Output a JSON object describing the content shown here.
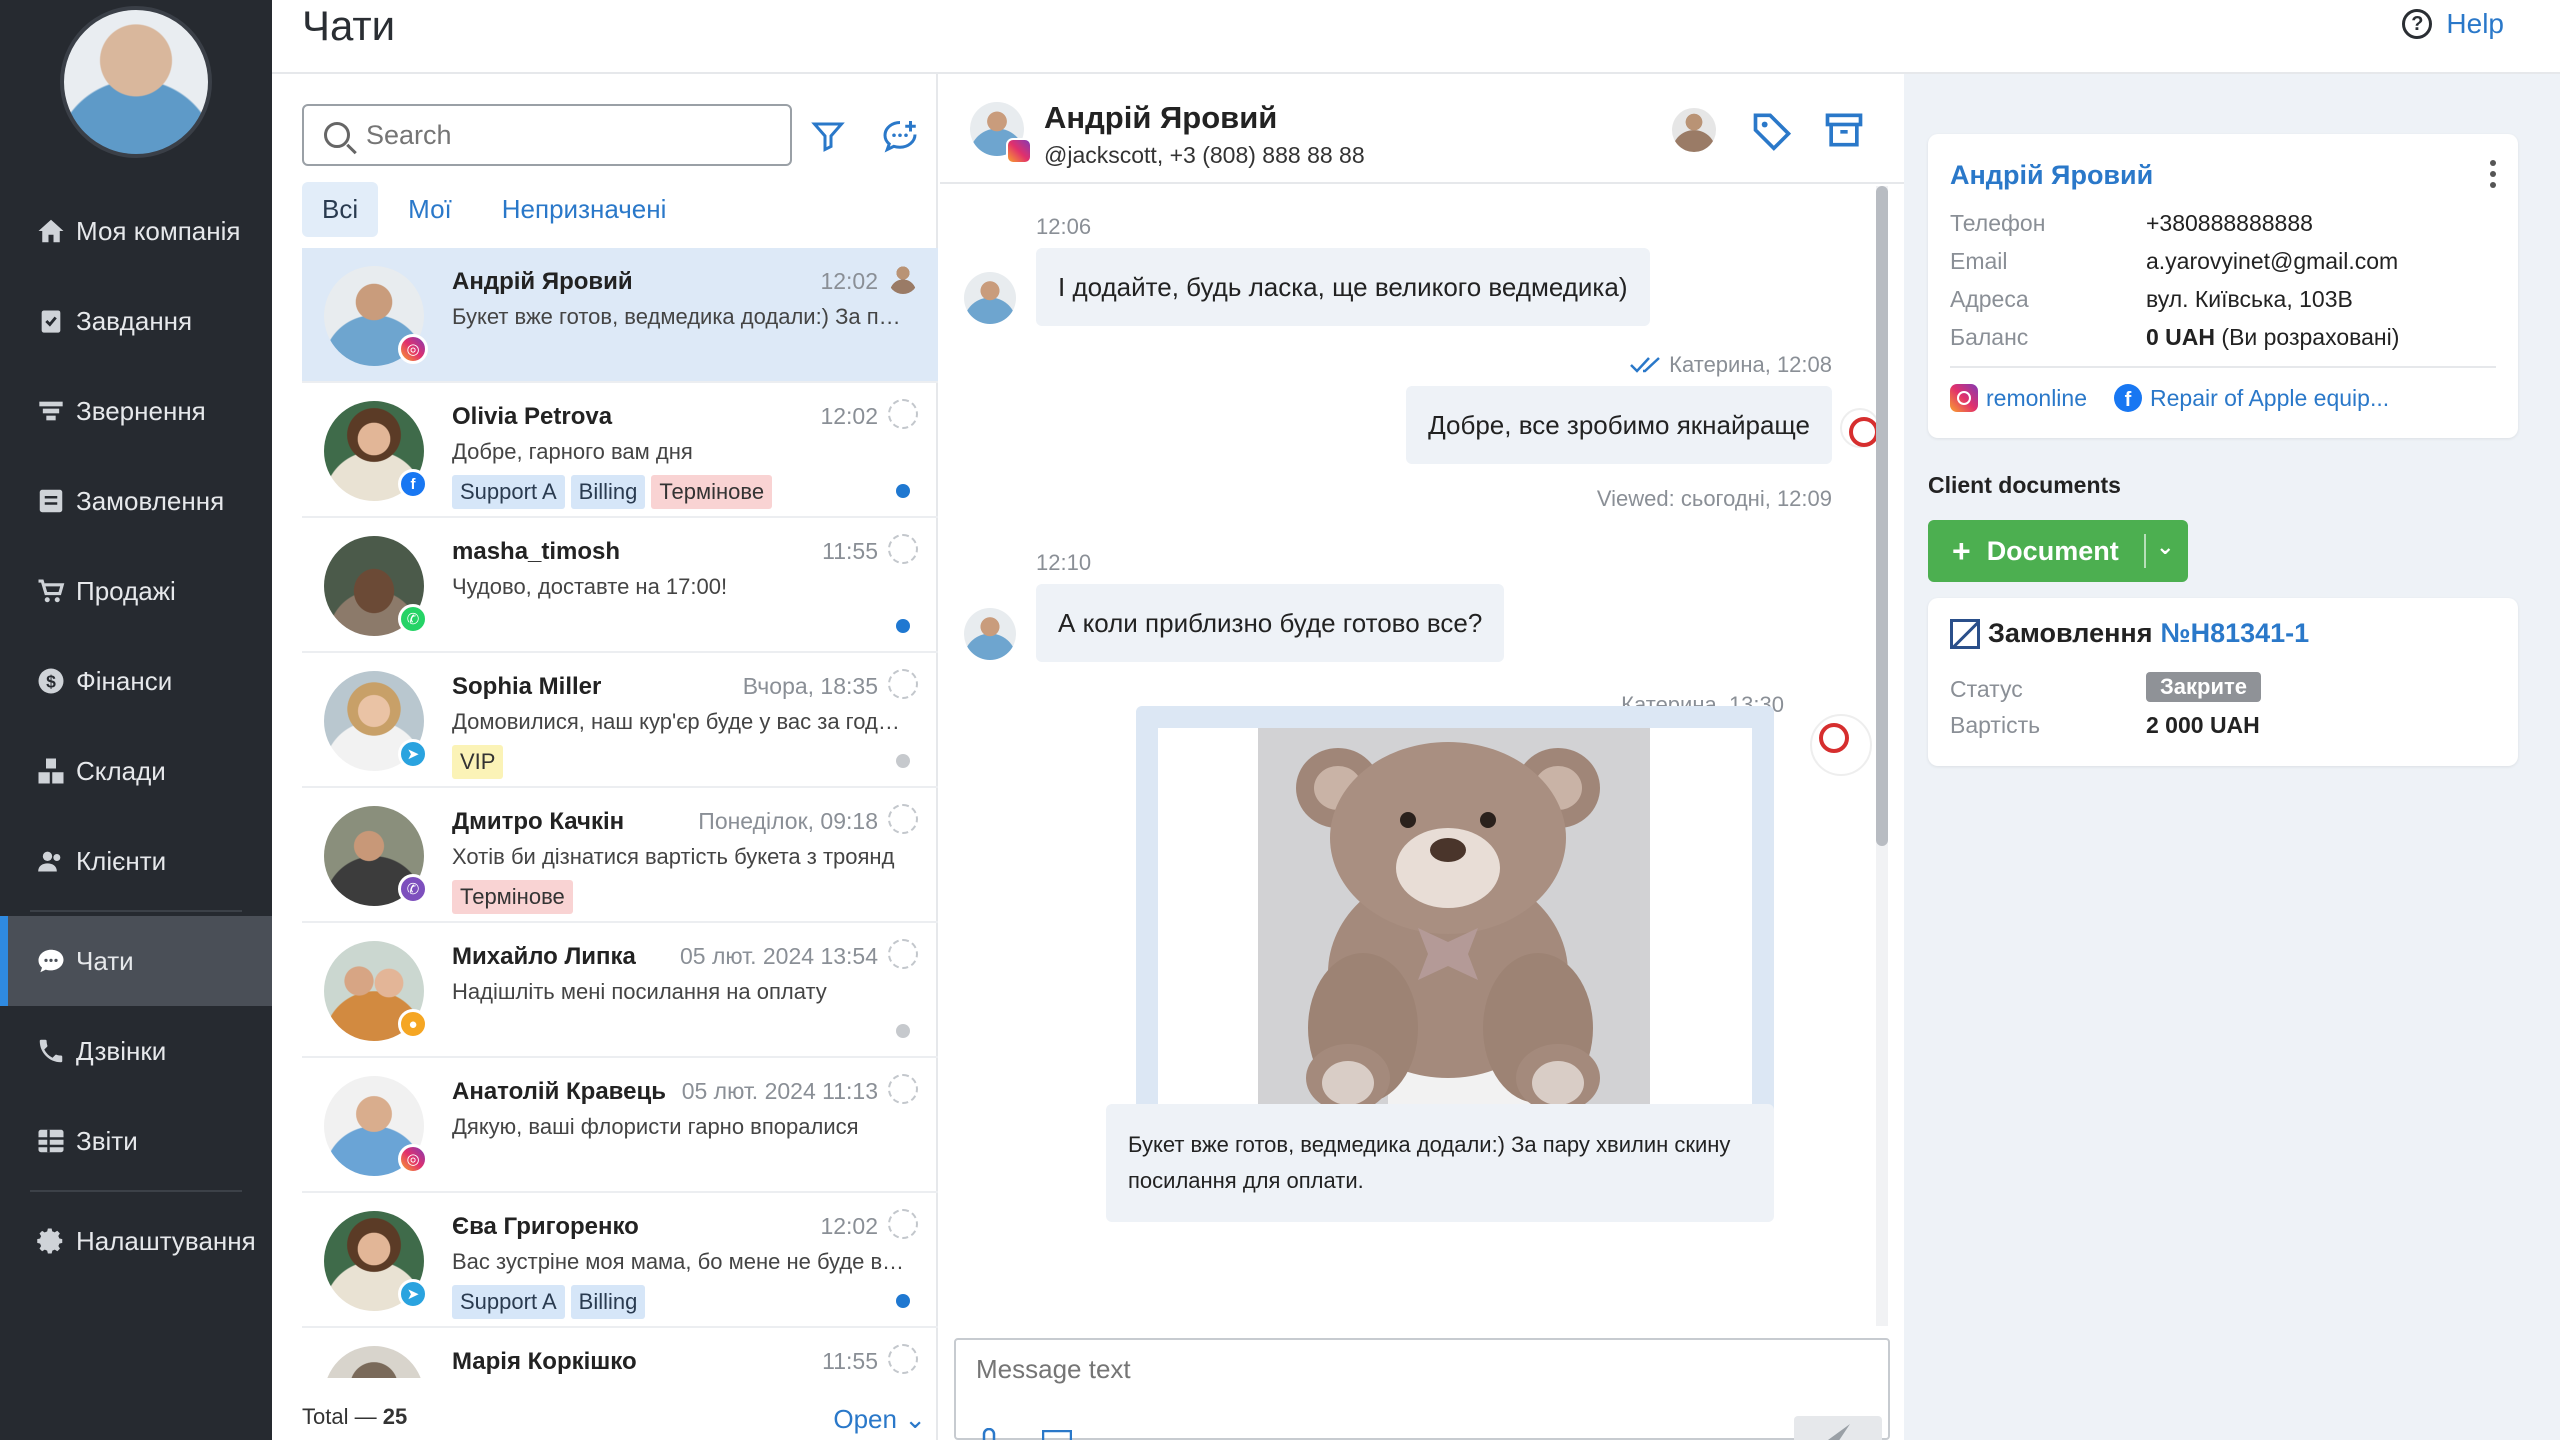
{
  "sidebar": {
    "items": [
      {
        "label": "Моя компанія",
        "icon": "home-icon"
      },
      {
        "label": "Завдання",
        "icon": "clipboard-icon"
      },
      {
        "label": "Звернення",
        "icon": "funnel-icon"
      },
      {
        "label": "Замовлення",
        "icon": "order-icon"
      },
      {
        "label": "Продажі",
        "icon": "cart-icon"
      },
      {
        "label": "Фінанси",
        "icon": "coin-icon"
      },
      {
        "label": "Склади",
        "icon": "boxes-icon"
      },
      {
        "label": "Клієнти",
        "icon": "users-icon"
      },
      {
        "label": "Чати",
        "icon": "chat-icon",
        "active": true
      },
      {
        "label": "Дзвінки",
        "icon": "phone-icon"
      },
      {
        "label": "Звіти",
        "icon": "reports-icon"
      },
      {
        "label": "Налаштування",
        "icon": "gear-icon"
      }
    ]
  },
  "header": {
    "title": "Чати",
    "help_label": "Help"
  },
  "chat_list": {
    "search_placeholder": "Search",
    "tabs": [
      "Всі",
      "Мої",
      "Непризначені"
    ],
    "rows": [
      {
        "name": "Андрій Яровий",
        "time": "12:02",
        "preview": "Букет вже готов, ведмедика додали:) За пару хвилин скину посилання для оплати.",
        "channel": "instagram",
        "tags": [],
        "dot": ""
      },
      {
        "name": "Olivia Petrova",
        "time": "12:02",
        "preview": "Добре, гарного вам дня",
        "channel": "facebook",
        "tags": [
          {
            "text": "Support A",
            "color": "blue"
          },
          {
            "text": "Billing",
            "color": "blue"
          },
          {
            "text": "Термінове",
            "color": "red"
          }
        ],
        "dot": "blue"
      },
      {
        "name": "masha_timosh",
        "time": "11:55",
        "preview": "Чудово, доставте на 17:00!",
        "channel": "whatsapp",
        "tags": [],
        "dot": "blue"
      },
      {
        "name": "Sophia Miller",
        "time": "Вчора, 18:35",
        "preview": "Домовилися, наш кур'єр буде у вас за годину",
        "channel": "telegram",
        "tags": [
          {
            "text": "VIP",
            "color": "yellow"
          }
        ],
        "dot": "grey"
      },
      {
        "name": "Дмитро Качкін",
        "time": "Понеділок, 09:18",
        "preview": "Хотів би дізнатися вартість букета з троянд",
        "channel": "viber",
        "tags": [
          {
            "text": "Термінове",
            "color": "red"
          }
        ],
        "dot": ""
      },
      {
        "name": "Михайло Липка",
        "time": "05 лют. 2024 13:54",
        "preview": "Надішліть мені посилання на оплату",
        "channel": "chat",
        "tags": [],
        "dot": "grey"
      },
      {
        "name": "Анатолій Кравець",
        "time": "05 лют. 2024 11:13",
        "preview": "Дякую, ваші флористи гарно впоралися",
        "channel": "instagram",
        "tags": [],
        "dot": ""
      },
      {
        "name": "Єва Григоренко",
        "time": "12:02",
        "preview": "Вас зустріне моя мама, бо мене не буде вдома",
        "channel": "telegram",
        "tags": [
          {
            "text": "Support A",
            "color": "blue"
          },
          {
            "text": "Billing",
            "color": "blue"
          }
        ],
        "dot": "blue"
      },
      {
        "name": "Марія Коркішко",
        "time": "11:55",
        "preview": "",
        "channel": "",
        "tags": [],
        "dot": ""
      }
    ],
    "footer": {
      "total_label": "Total —",
      "total_value": "25",
      "open_label": "Open"
    }
  },
  "chat": {
    "name": "Андрій Яровий",
    "subtitle": "@jackscott, +3 (808) 888 88 88",
    "messages": {
      "t1": "12:06",
      "m1": "І додайте, будь ласка, ще великого ведмедика)",
      "t2": "Катерина, 12:08",
      "m2": "Добре, все зробимо якнайраще",
      "viewed": "Viewed: сьогодні, 12:09",
      "t3": "12:10",
      "m3": "А коли приблизно буде готово все?",
      "t4": "Катерина, 13:30",
      "m4": "Букет вже готов, ведмедика додали:) За пару хвилин скину посилання для оплати."
    },
    "composer_placeholder": "Message text"
  },
  "contact": {
    "name": "Андрій Яровий",
    "fields": [
      {
        "key": "Телефон",
        "value": "+380888888888"
      },
      {
        "key": "Email",
        "value": "a.yarovyinet@gmail.com"
      },
      {
        "key": "Адреса",
        "value": "вул. Київська, 103B"
      },
      {
        "key": "Баланс",
        "value_bold": "0 UAH",
        "value": " (Ви розраховані)"
      }
    ],
    "social_ig": "remonline",
    "social_fb": "Repair of Apple equip..."
  },
  "documents": {
    "title": "Client documents",
    "button_label": "Document",
    "order": {
      "title": "Замовлення",
      "number": "№H81341-1",
      "status_key": "Статус",
      "status_value": "Закрите",
      "cost_key": "Вартість",
      "cost_value": "2 000 UAH"
    }
  },
  "colors": {
    "accent": "#2a78c9",
    "sidebar": "#262a30",
    "success": "#4caf50",
    "selected_row": "#dde9f7"
  }
}
